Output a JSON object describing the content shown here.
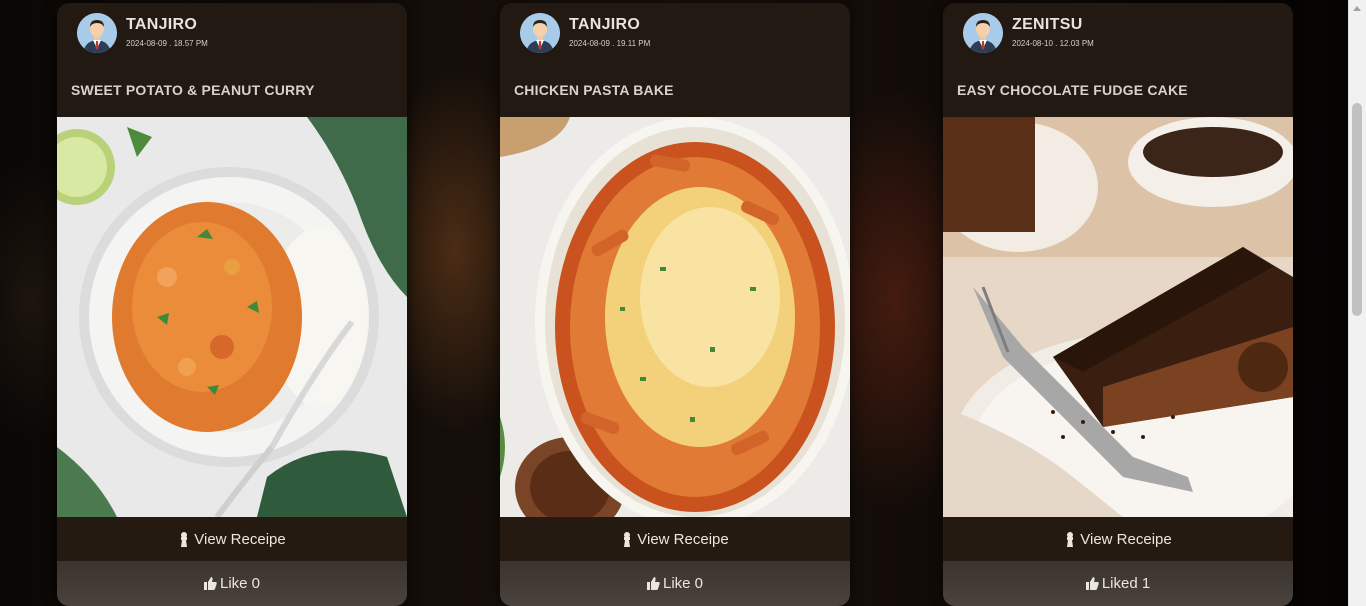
{
  "cards": [
    {
      "author": "TANJIRO",
      "date": "2024-08-09 . 18.57 PM",
      "title": "SWEET POTATO & PEANUT CURRY",
      "view_label": "View Receipe",
      "like_label": "Like 0",
      "image_icon": "curry-photo"
    },
    {
      "author": "TANJIRO",
      "date": "2024-08-09 . 19.11 PM",
      "title": "CHICKEN PASTA BAKE",
      "view_label": "View Receipe",
      "like_label": "Like 0",
      "image_icon": "pasta-photo"
    },
    {
      "author": "ZENITSU",
      "date": "2024-08-10 . 12.03 PM",
      "title": "EASY CHOCOLATE FUDGE CAKE",
      "view_label": "View Receipe",
      "like_label": "Liked 1",
      "image_icon": "cake-photo"
    }
  ],
  "icons": {
    "avatar": "user-avatar-icon",
    "view": "chef-icon",
    "like": "thumbs-up-icon"
  },
  "colors": {
    "card_bg": "#221912",
    "view_bg": "#241a12",
    "like_bg": "#3b332e",
    "text": "#ebe6df",
    "avatar_bg": "#9fc4e4"
  }
}
